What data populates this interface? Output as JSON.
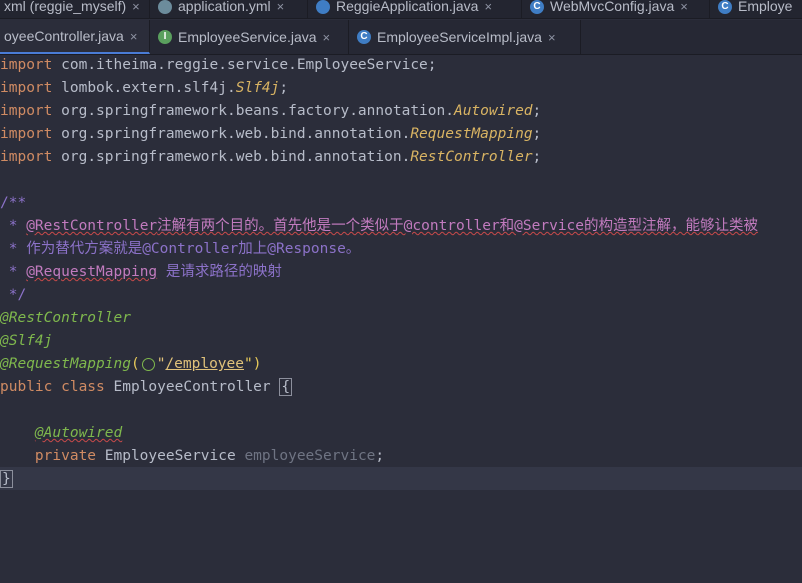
{
  "top_tabs": [
    {
      "label": "xml (reggie_myself)",
      "icon": "maven-icon"
    },
    {
      "label": "application.yml",
      "icon": "yml-icon"
    },
    {
      "label": "ReggieApplication.java",
      "icon": "class-icon"
    },
    {
      "label": "WebMvcConfig.java",
      "icon": "class-icon"
    },
    {
      "label": "Employe",
      "icon": "class-icon"
    }
  ],
  "second_tabs": [
    {
      "label": "oyeeController.java",
      "icon": "class-icon",
      "active": true
    },
    {
      "label": "EmployeeService.java",
      "icon": "interface-icon",
      "active": false
    },
    {
      "label": "EmployeeServiceImpl.java",
      "icon": "class-icon",
      "active": false
    }
  ],
  "close_glyph": "×",
  "icon_letters": {
    "interface": "I",
    "class": "C"
  },
  "code": {
    "import_kw": "import",
    "import1": "com.itheima.reggie.service.EmployeeService;",
    "import2_pkg": "lombok.extern.slf4j.",
    "import2_cls": "Slf4j",
    "import3_pkg": "org.springframework.beans.factory.annotation.",
    "import3_cls": "Autowired",
    "import4_pkg": "org.springframework.web.bind.annotation.",
    "import4_cls": "RequestMapping",
    "import5_pkg": "org.springframework.web.bind.annotation.",
    "import5_cls": "RestController",
    "semi": ";",
    "doc_open": "/**",
    "doc_star": " * ",
    "doc1_tag": "@RestController",
    "doc1_text": "注解有两个目的。首先他是一个类似于@controller和@Service的构造型注解，能够让类被",
    "doc2_text": "作为替代方案就是@Controller加上@Response。",
    "doc3_tag": "@RequestMapping",
    "doc3_text": " 是请求路径的映射",
    "doc_close": " */",
    "ann_restcontroller": "@RestController",
    "ann_slf4j": "@Slf4j",
    "ann_requestmapping": "@RequestMapping",
    "rm_open": "(",
    "rm_quote_open": "\"",
    "rm_path": "/employee",
    "rm_close": "\")",
    "class_decl_kw": "public class ",
    "class_name": "EmployeeController ",
    "brace_open": "{",
    "ann_autowired": "@Autowired",
    "field_kw": "private ",
    "field_type": "EmployeeService ",
    "field_name": "employeeService",
    "brace_close": "}"
  }
}
